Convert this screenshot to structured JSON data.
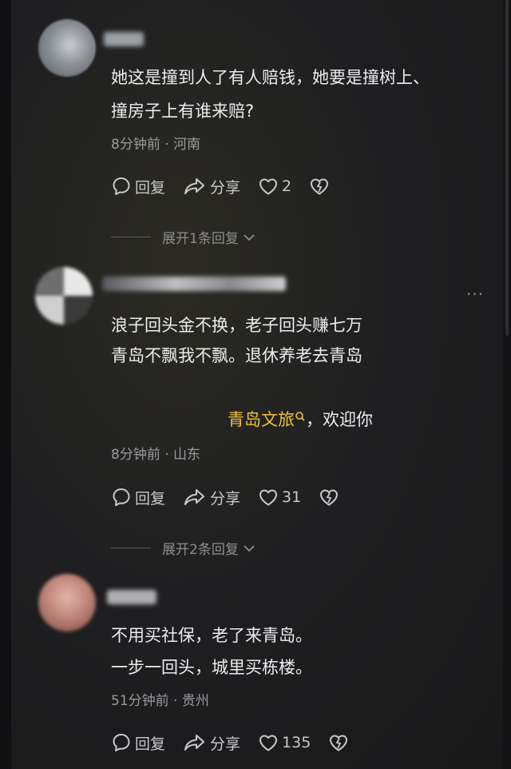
{
  "comments": [
    {
      "text_lines": [
        "她这是撞到人了有人赔钱，她要是撞树上、",
        "撞房子上有谁来赔?"
      ],
      "meta": "8分钟前 · 河南",
      "reply_label": "回复",
      "share_label": "分享",
      "like_count": "2",
      "expand_label": "展开1条回复"
    },
    {
      "text_lines": [
        "浪子回头金不换，老子回头赚七万",
        "青岛不飘我不飘。退休养老去青岛"
      ],
      "link_text": "青岛文旅",
      "link_suffix": "，欢迎你",
      "meta": "8分钟前 · 山东",
      "reply_label": "回复",
      "share_label": "分享",
      "like_count": "31",
      "expand_label": "展开2条回复",
      "more_label": "···"
    },
    {
      "text_lines": [
        "不用买社保，老了来青岛。",
        "一步一回头，城里买栋楼。"
      ],
      "meta": "51分钟前 · 贵州",
      "reply_label": "回复",
      "share_label": "分享",
      "like_count": "135"
    }
  ],
  "colors": {
    "link": "#f0c23a",
    "background": "#1f1f21"
  }
}
